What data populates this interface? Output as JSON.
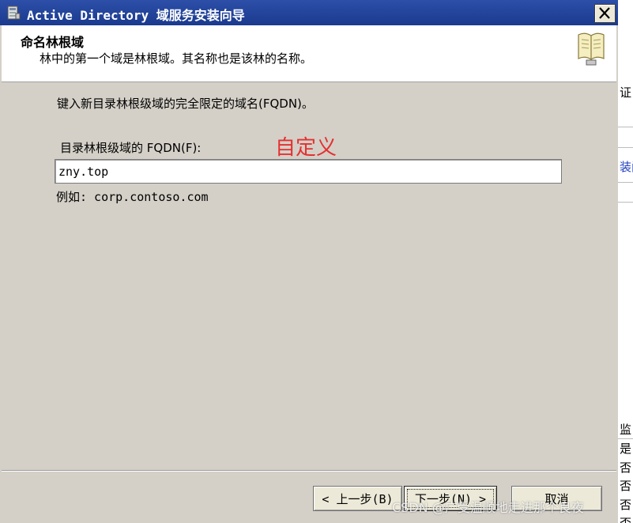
{
  "window": {
    "title": "Active Directory 域服务安装向导",
    "close_label": "X"
  },
  "header": {
    "title": "命名林根域",
    "subtitle": "林中的第一个域是林根域。其名称也是该林的名称。"
  },
  "content": {
    "instruction": "键入新目录林根级域的完全限定的域名(FQDN)。",
    "fqdn_label": "目录林根级域的 FQDN(F):",
    "annotation": "自定义",
    "fqdn_value": "zny.top",
    "example": "例如: corp.contoso.com"
  },
  "buttons": {
    "back": "< 上一步(B)",
    "next": "下一步(N) >",
    "cancel": "取消"
  },
  "background_fragments": {
    "frag_1": "证",
    "frag_2": "装问",
    "frag_3": "监",
    "frag_4": "是",
    "frag_5": "否",
    "frag_6": "否",
    "frag_7": "否",
    "frag_8": "否"
  },
  "watermark": "CSDN @广受温顺地走进那个良夜",
  "colors": {
    "titlebar": "#1a3a8e",
    "annotation": "#e53030",
    "dialog_bg": "#d4d0c8"
  }
}
